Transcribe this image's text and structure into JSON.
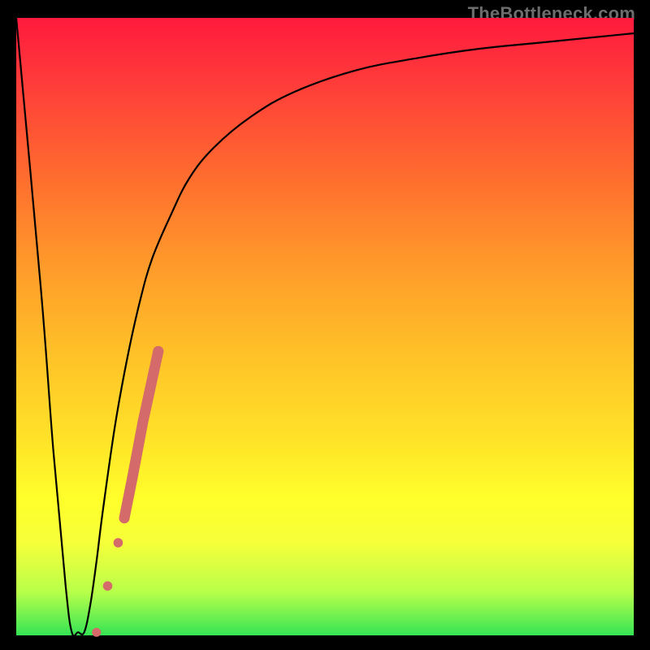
{
  "watermark": "TheBottleneck.com",
  "colors": {
    "curve_stroke": "#000000",
    "marker_fill": "#d46a6a",
    "marker_stroke": "#b85050"
  },
  "chart_data": {
    "type": "line",
    "title": "",
    "xlabel": "",
    "ylabel": "",
    "xlim": [
      0,
      100
    ],
    "ylim": [
      0,
      100
    ],
    "x": [
      0,
      4,
      6,
      8,
      9,
      10,
      11,
      12,
      13,
      14,
      16,
      18,
      20,
      22,
      25,
      28,
      32,
      38,
      45,
      55,
      65,
      75,
      85,
      95,
      100
    ],
    "values": [
      100,
      56,
      30,
      8,
      0.5,
      0.5,
      0.5,
      5,
      12,
      20,
      34,
      45,
      54,
      61,
      68,
      74,
      79,
      84,
      88,
      91.5,
      93.5,
      95,
      96,
      97,
      97.5
    ],
    "markers": [
      {
        "x": 13.0,
        "y": 0.5
      },
      {
        "x": 14.8,
        "y": 8.0
      },
      {
        "x": 16.5,
        "y": 15.0
      },
      {
        "x": 17.5,
        "y": 19.0
      },
      {
        "x": 18.8,
        "y": 25.5
      },
      {
        "x": 20.5,
        "y": 34.5
      },
      {
        "x": 23.0,
        "y": 46.0
      }
    ]
  }
}
